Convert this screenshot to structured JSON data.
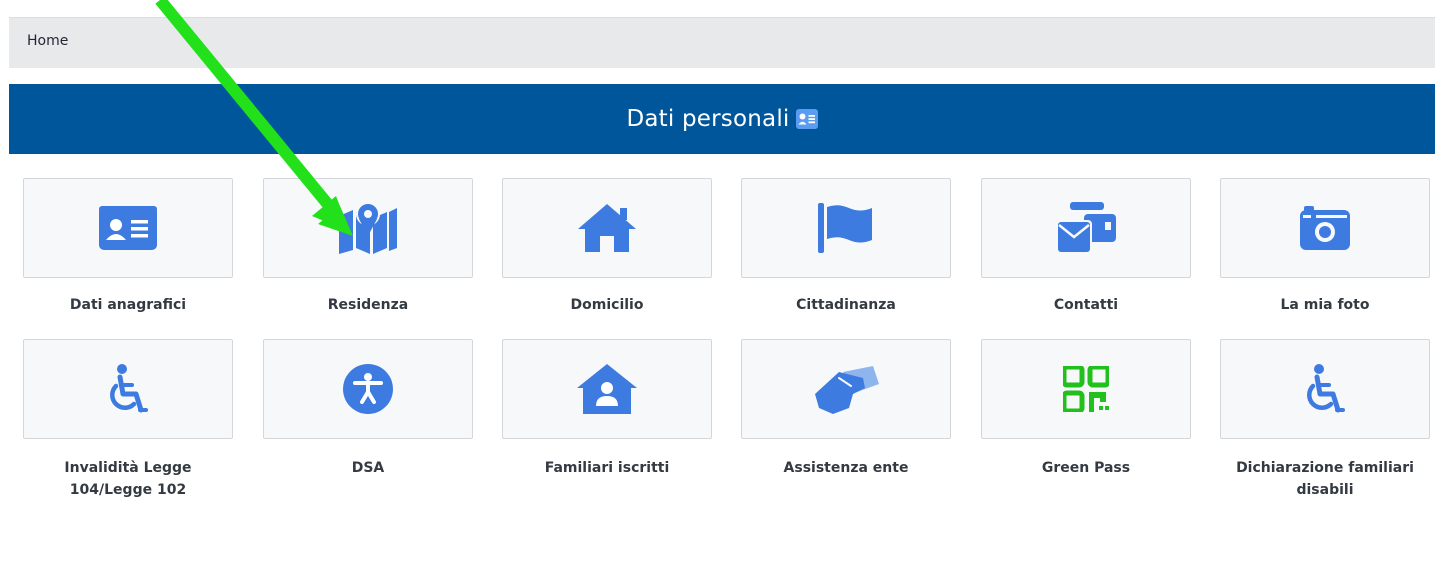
{
  "breadcrumb": {
    "home": "Home"
  },
  "header": {
    "title": "Dati personali",
    "icon": "id-card-icon"
  },
  "accent": "#3d7be0",
  "header_color": "#00569b",
  "annotation_color": "#22e01a",
  "tiles": [
    {
      "label": "Dati anagrafici",
      "icon": "id-card-icon"
    },
    {
      "label": "Residenza",
      "icon": "map-location-icon"
    },
    {
      "label": "Domicilio",
      "icon": "home-icon"
    },
    {
      "label": "Cittadinanza",
      "icon": "flag-icon"
    },
    {
      "label": "Contatti",
      "icon": "contact-envelope-icon"
    },
    {
      "label": "La mia foto",
      "icon": "camera-icon"
    },
    {
      "label": "Invalidità Legge 104/Legge 102",
      "icon": "wheelchair-icon"
    },
    {
      "label": "DSA",
      "icon": "universal-access-icon"
    },
    {
      "label": "Familiari iscritti",
      "icon": "house-user-icon"
    },
    {
      "label": "Assistenza ente",
      "icon": "handshake-icon"
    },
    {
      "label": "Green Pass",
      "icon": "qr-code-icon"
    },
    {
      "label": "Dichiarazione familiari disabili",
      "icon": "wheelchair-icon"
    }
  ]
}
